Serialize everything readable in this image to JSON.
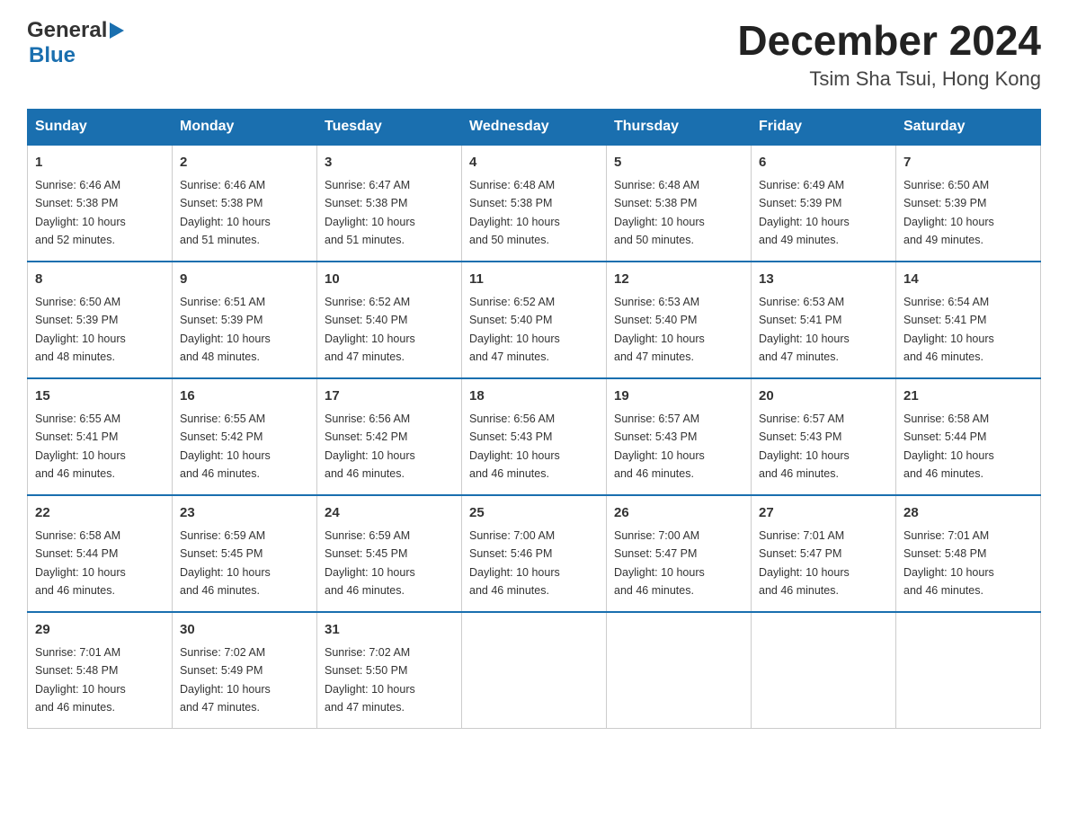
{
  "header": {
    "logo_general": "General",
    "logo_blue": "Blue",
    "title": "December 2024",
    "subtitle": "Tsim Sha Tsui, Hong Kong"
  },
  "weekdays": [
    "Sunday",
    "Monday",
    "Tuesday",
    "Wednesday",
    "Thursday",
    "Friday",
    "Saturday"
  ],
  "weeks": [
    [
      {
        "day": "1",
        "sunrise": "6:46 AM",
        "sunset": "5:38 PM",
        "daylight": "10 hours and 52 minutes."
      },
      {
        "day": "2",
        "sunrise": "6:46 AM",
        "sunset": "5:38 PM",
        "daylight": "10 hours and 51 minutes."
      },
      {
        "day": "3",
        "sunrise": "6:47 AM",
        "sunset": "5:38 PM",
        "daylight": "10 hours and 51 minutes."
      },
      {
        "day": "4",
        "sunrise": "6:48 AM",
        "sunset": "5:38 PM",
        "daylight": "10 hours and 50 minutes."
      },
      {
        "day": "5",
        "sunrise": "6:48 AM",
        "sunset": "5:38 PM",
        "daylight": "10 hours and 50 minutes."
      },
      {
        "day": "6",
        "sunrise": "6:49 AM",
        "sunset": "5:39 PM",
        "daylight": "10 hours and 49 minutes."
      },
      {
        "day": "7",
        "sunrise": "6:50 AM",
        "sunset": "5:39 PM",
        "daylight": "10 hours and 49 minutes."
      }
    ],
    [
      {
        "day": "8",
        "sunrise": "6:50 AM",
        "sunset": "5:39 PM",
        "daylight": "10 hours and 48 minutes."
      },
      {
        "day": "9",
        "sunrise": "6:51 AM",
        "sunset": "5:39 PM",
        "daylight": "10 hours and 48 minutes."
      },
      {
        "day": "10",
        "sunrise": "6:52 AM",
        "sunset": "5:40 PM",
        "daylight": "10 hours and 47 minutes."
      },
      {
        "day": "11",
        "sunrise": "6:52 AM",
        "sunset": "5:40 PM",
        "daylight": "10 hours and 47 minutes."
      },
      {
        "day": "12",
        "sunrise": "6:53 AM",
        "sunset": "5:40 PM",
        "daylight": "10 hours and 47 minutes."
      },
      {
        "day": "13",
        "sunrise": "6:53 AM",
        "sunset": "5:41 PM",
        "daylight": "10 hours and 47 minutes."
      },
      {
        "day": "14",
        "sunrise": "6:54 AM",
        "sunset": "5:41 PM",
        "daylight": "10 hours and 46 minutes."
      }
    ],
    [
      {
        "day": "15",
        "sunrise": "6:55 AM",
        "sunset": "5:41 PM",
        "daylight": "10 hours and 46 minutes."
      },
      {
        "day": "16",
        "sunrise": "6:55 AM",
        "sunset": "5:42 PM",
        "daylight": "10 hours and 46 minutes."
      },
      {
        "day": "17",
        "sunrise": "6:56 AM",
        "sunset": "5:42 PM",
        "daylight": "10 hours and 46 minutes."
      },
      {
        "day": "18",
        "sunrise": "6:56 AM",
        "sunset": "5:43 PM",
        "daylight": "10 hours and 46 minutes."
      },
      {
        "day": "19",
        "sunrise": "6:57 AM",
        "sunset": "5:43 PM",
        "daylight": "10 hours and 46 minutes."
      },
      {
        "day": "20",
        "sunrise": "6:57 AM",
        "sunset": "5:43 PM",
        "daylight": "10 hours and 46 minutes."
      },
      {
        "day": "21",
        "sunrise": "6:58 AM",
        "sunset": "5:44 PM",
        "daylight": "10 hours and 46 minutes."
      }
    ],
    [
      {
        "day": "22",
        "sunrise": "6:58 AM",
        "sunset": "5:44 PM",
        "daylight": "10 hours and 46 minutes."
      },
      {
        "day": "23",
        "sunrise": "6:59 AM",
        "sunset": "5:45 PM",
        "daylight": "10 hours and 46 minutes."
      },
      {
        "day": "24",
        "sunrise": "6:59 AM",
        "sunset": "5:45 PM",
        "daylight": "10 hours and 46 minutes."
      },
      {
        "day": "25",
        "sunrise": "7:00 AM",
        "sunset": "5:46 PM",
        "daylight": "10 hours and 46 minutes."
      },
      {
        "day": "26",
        "sunrise": "7:00 AM",
        "sunset": "5:47 PM",
        "daylight": "10 hours and 46 minutes."
      },
      {
        "day": "27",
        "sunrise": "7:01 AM",
        "sunset": "5:47 PM",
        "daylight": "10 hours and 46 minutes."
      },
      {
        "day": "28",
        "sunrise": "7:01 AM",
        "sunset": "5:48 PM",
        "daylight": "10 hours and 46 minutes."
      }
    ],
    [
      {
        "day": "29",
        "sunrise": "7:01 AM",
        "sunset": "5:48 PM",
        "daylight": "10 hours and 46 minutes."
      },
      {
        "day": "30",
        "sunrise": "7:02 AM",
        "sunset": "5:49 PM",
        "daylight": "10 hours and 47 minutes."
      },
      {
        "day": "31",
        "sunrise": "7:02 AM",
        "sunset": "5:50 PM",
        "daylight": "10 hours and 47 minutes."
      },
      null,
      null,
      null,
      null
    ]
  ],
  "labels": {
    "sunrise": "Sunrise:",
    "sunset": "Sunset:",
    "daylight": "Daylight:"
  }
}
